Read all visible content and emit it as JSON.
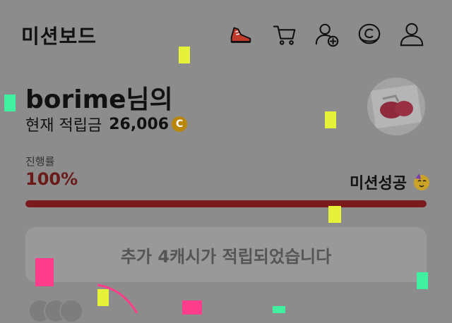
{
  "header": {
    "title": "미션보드",
    "icons": [
      "sneaker-icon",
      "cart-icon",
      "add-friend-icon",
      "coin-icon",
      "profile-icon"
    ]
  },
  "user": {
    "greeting": "borime님의",
    "points_label": "현재 적립금",
    "points_value": "26,006",
    "coin_symbol": "C"
  },
  "progress": {
    "label": "진행률",
    "value_text": "100%",
    "fraction": 1.0,
    "status": "미션성공"
  },
  "notice": {
    "text": "추가 4캐시가 적립되었습니다"
  },
  "colors": {
    "overlay": "#8c8c8c",
    "progress_fill": "#7a1a1a",
    "progress_text": "#6b1a1a",
    "coin": "#b8860b",
    "confetti_yellow": "#e6f23a",
    "confetti_green": "#3ff0a0",
    "confetti_pink": "#ff3d8b"
  }
}
